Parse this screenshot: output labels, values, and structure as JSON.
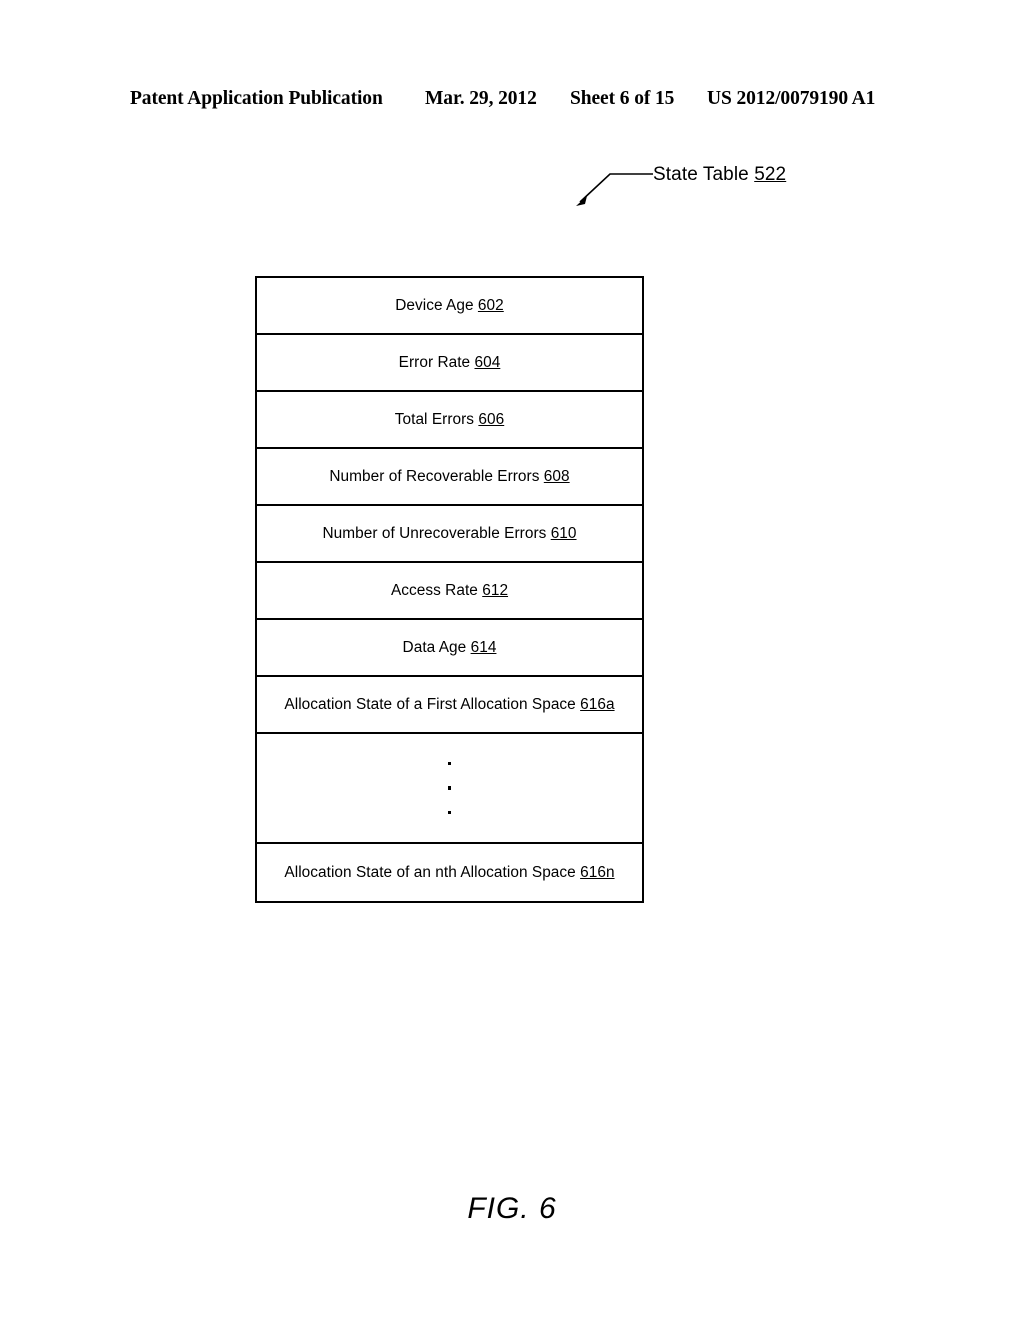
{
  "header": {
    "publication": "Patent Application Publication",
    "date": "Mar. 29, 2012",
    "sheet": "Sheet 6 of 15",
    "patent_number": "US 2012/0079190 A1"
  },
  "callout": {
    "label": "State Table ",
    "ref": "522"
  },
  "state_table": {
    "rows": [
      {
        "label": "Device Age ",
        "ref": "602"
      },
      {
        "label": "Error Rate ",
        "ref": "604"
      },
      {
        "label": "Total Errors ",
        "ref": "606"
      },
      {
        "label": "Number of Recoverable Errors ",
        "ref": "608"
      },
      {
        "label": "Number of Unrecoverable Errors ",
        "ref": "610"
      },
      {
        "label": "Access Rate ",
        "ref": "612"
      },
      {
        "label": "Data Age ",
        "ref": "614"
      },
      {
        "label": "Allocation State of a First Allocation Space ",
        "ref": "616a"
      },
      {
        "label": "Allocation State of an nth Allocation Space ",
        "ref": "616n"
      }
    ]
  },
  "figure": {
    "caption": "FIG. 6"
  }
}
